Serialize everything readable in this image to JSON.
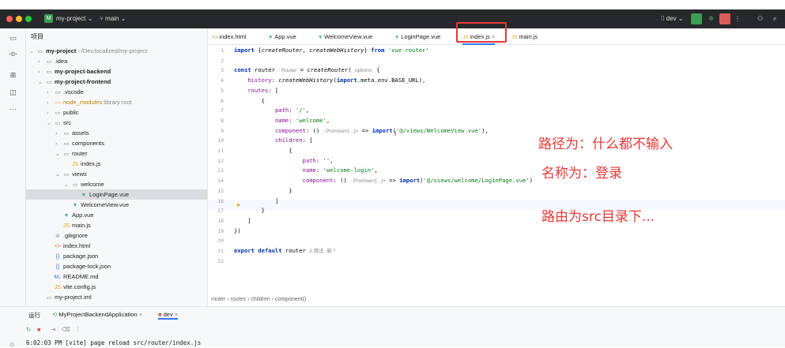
{
  "titlebar": {
    "project_badge": "M",
    "project_name": "my-project",
    "branch": "main",
    "run_config": "dev"
  },
  "sidebar": {
    "title": "项目"
  },
  "tree": [
    {
      "depth": 0,
      "chev": "⌄",
      "icon": "folder",
      "name": "my-project",
      "bold": true,
      "extra": "~/Dev.localized/my-project"
    },
    {
      "depth": 1,
      "chev": "›",
      "icon": "folder",
      "name": ".idea",
      "bold": false,
      "extra": ""
    },
    {
      "depth": 1,
      "chev": "›",
      "icon": "folder",
      "name": "my-project-backend",
      "bold": true,
      "extra": ""
    },
    {
      "depth": 1,
      "chev": "⌄",
      "icon": "folder",
      "name": "my-project-frontend",
      "bold": true,
      "extra": ""
    },
    {
      "depth": 2,
      "chev": "›",
      "icon": "folder",
      "name": ".vscode",
      "bold": false,
      "extra": ""
    },
    {
      "depth": 2,
      "chev": "›",
      "icon": "folder-lib",
      "name": "node_modules",
      "bold": false,
      "extra": "library root"
    },
    {
      "depth": 2,
      "chev": "›",
      "icon": "folder",
      "name": "public",
      "bold": false,
      "extra": ""
    },
    {
      "depth": 2,
      "chev": "⌄",
      "icon": "folder",
      "name": "src",
      "bold": false,
      "extra": ""
    },
    {
      "depth": 3,
      "chev": "›",
      "icon": "folder",
      "name": "assets",
      "bold": false,
      "extra": ""
    },
    {
      "depth": 3,
      "chev": "›",
      "icon": "folder",
      "name": "components",
      "bold": false,
      "extra": ""
    },
    {
      "depth": 3,
      "chev": "⌄",
      "icon": "folder",
      "name": "router",
      "bold": false,
      "extra": ""
    },
    {
      "depth": 4,
      "chev": "",
      "icon": "js",
      "name": "index.js",
      "bold": false,
      "extra": ""
    },
    {
      "depth": 3,
      "chev": "⌄",
      "icon": "folder",
      "name": "views",
      "bold": false,
      "extra": ""
    },
    {
      "depth": 4,
      "chev": "⌄",
      "icon": "folder",
      "name": "welcome",
      "bold": false,
      "extra": ""
    },
    {
      "depth": 5,
      "chev": "",
      "icon": "vue",
      "name": "LoginPage.vue",
      "bold": false,
      "extra": "",
      "selected": true
    },
    {
      "depth": 4,
      "chev": "",
      "icon": "vue",
      "name": "WelcomeView.vue",
      "bold": false,
      "extra": ""
    },
    {
      "depth": 3,
      "chev": "",
      "icon": "vue",
      "name": "App.vue",
      "bold": false,
      "extra": ""
    },
    {
      "depth": 3,
      "chev": "",
      "icon": "js",
      "name": "main.js",
      "bold": false,
      "extra": ""
    },
    {
      "depth": 2,
      "chev": "",
      "icon": "git",
      "name": ".gitignore",
      "bold": false,
      "extra": ""
    },
    {
      "depth": 2,
      "chev": "",
      "icon": "html",
      "name": "index.html",
      "bold": false,
      "extra": ""
    },
    {
      "depth": 2,
      "chev": "",
      "icon": "json",
      "name": "package.json",
      "bold": false,
      "extra": ""
    },
    {
      "depth": 2,
      "chev": "",
      "icon": "json",
      "name": "package-lock.json",
      "bold": false,
      "extra": ""
    },
    {
      "depth": 2,
      "chev": "",
      "icon": "md",
      "name": "README.md",
      "bold": false,
      "extra": ""
    },
    {
      "depth": 2,
      "chev": "",
      "icon": "js",
      "name": "vite.config.js",
      "bold": false,
      "extra": ""
    },
    {
      "depth": 1,
      "chev": "",
      "icon": "iml",
      "name": "my-project.iml",
      "bold": false,
      "extra": ""
    }
  ],
  "tabs": [
    {
      "icon": "html",
      "label": "index.html"
    },
    {
      "icon": "vue",
      "label": "App.vue"
    },
    {
      "icon": "vue",
      "label": "WelcomeView.vue"
    },
    {
      "icon": "vue",
      "label": "LoginPage.vue"
    },
    {
      "icon": "js",
      "label": "index.js",
      "active": true
    },
    {
      "icon": "js",
      "label": "main.js"
    }
  ],
  "code_lines": [
    "<span class='kw'>import</span> {<span class='fn'>createRouter</span>, <span class='fn'>createWebHistory</span>} <span class='kw'>from</span> <span class='str'>'vue-router'</span>",
    "",
    "<span class='kw'>const</span> router <span class='hint'>: Router</span> = <span class='fn'>createRouter</span>( <span class='hint'>options:</span> {",
    "    <span class='prop'>history</span>: <span class='fn'>createWebHistory</span>(<span class='kw'>import</span>.meta.env.BASE_URL),",
    "    <span class='prop'>routes</span>: [",
    "        {",
    "            <span class='prop'>path</span>: <span class='str'>'/'</span>,",
    "            <span class='prop'>name</span>: <span class='str'>'welcome'</span>,",
    "            <span class='prop'>component</span>: () <span class='hint'>: Promise&lt;{...}&gt;</span> =&gt; <span class='kw'>import</span>(<span class='str'>'@/views/WelcomeView.vue'</span>),",
    "            <span class='prop'>children</span>: [",
    "                {",
    "                    <span class='prop'>path</span>: <span class='str'>''</span>,",
    "                    <span class='prop'>name</span>: <span class='str'>'welcome-login'</span>,",
    "                    <span class='prop'>component</span>: () <span class='hint'>: Promise&lt;{...}&gt;</span> =&gt; <span class='kw'>import</span>(<span class='str'>'@/views/welcome/LoginPage.vue'</span>)",
    "                }",
    "            ]",
    "        }",
    "    ]",
    "})",
    "",
    "<span class='kw'>export default</span> router <span class='hint'>2 用法  新 *</span>",
    ""
  ],
  "annotations": [
    "路径为：什么都不输入",
    "名称为：登录",
    "路由为src目录下..."
  ],
  "breadcrumb": [
    "router",
    "routes",
    "children",
    "component()"
  ],
  "bottom": {
    "label": "运行",
    "tabs": [
      "MyProjectBackendApplication",
      "dev"
    ],
    "console_line": "6:02:03 PM [vite] page reload src/router/index.js"
  },
  "colors": {
    "accent": "#3574f0",
    "annotation": "#e53935",
    "vue": "#41b883",
    "js": "#e8a500"
  }
}
